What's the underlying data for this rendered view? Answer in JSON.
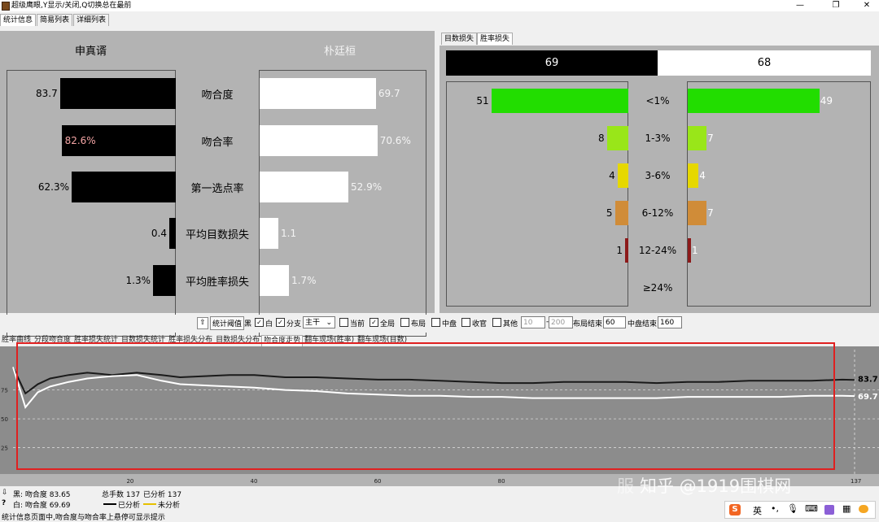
{
  "window": {
    "title": "超级鹰眼,Y显示/关闭,Q切换总在最前",
    "controls": [
      "—",
      "❐",
      "✕"
    ]
  },
  "main_tabs": [
    "统计信息",
    "简易列表",
    "详细列表"
  ],
  "left_stats": {
    "black_player": "申真谞",
    "white_player": "朴廷桓",
    "categories": [
      "吻合度",
      "吻合率",
      "第一选点率",
      "平均目数损失",
      "平均胜率损失"
    ],
    "black_values": [
      83.7,
      82.6,
      62.3,
      0.4,
      1.3
    ],
    "white_values": [
      69.7,
      70.6,
      52.9,
      1.1,
      1.7
    ],
    "black_labels": [
      "83.7",
      "82.6%",
      "62.3%",
      "0.4",
      "1.3%"
    ],
    "white_labels": [
      "69.7",
      "70.6%",
      "52.9%",
      "1.1",
      "1.7%"
    ],
    "black_color": "#000000",
    "white_color": "#ffffff"
  },
  "right_stats": {
    "tabs": [
      "目数损失",
      "胜率损失"
    ],
    "black_total": "69",
    "white_total": "68",
    "ranges": [
      "<1%",
      "1-3%",
      "3-6%",
      "6-12%",
      "12-24%",
      "≥24%"
    ],
    "black_counts": [
      51,
      8,
      4,
      5,
      1,
      0
    ],
    "white_counts": [
      49,
      7,
      4,
      7,
      1,
      0
    ],
    "colors": [
      "#22dd00",
      "#99e619",
      "#e6d800",
      "#d08c38",
      "#8c1a1a",
      "#000000"
    ]
  },
  "controls": {
    "button": "统计阈值",
    "labels": {
      "black": "黑",
      "white": "白",
      "branch": "分支",
      "current": "当前",
      "whole": "全局",
      "opening": "布局",
      "middle": "中盘",
      "end": "收官",
      "other": "其他",
      "opening_end": "布局结束",
      "middle_end": "中盘结束"
    },
    "checked": {
      "black": true,
      "white": true,
      "branch": true,
      "current": false,
      "whole": true,
      "opening": false,
      "middle": false,
      "end": false,
      "other": false
    },
    "select_value": "主干",
    "range_from": "10",
    "range_to": "200",
    "opening_end_value": "60",
    "middle_end_value": "160"
  },
  "bottom_tabs": [
    "胜率曲线",
    "分段吻合度",
    "胜率损失统计",
    "目数损失统计",
    "胜率损失分布",
    "目数损失分布",
    "吻合度走势",
    "翻车现场(胜率)",
    "翻车现场(目数)"
  ],
  "chart_data": {
    "type": "line",
    "title": "吻合度走势",
    "xlabel": "",
    "ylabel": "",
    "xlim": [
      1,
      137
    ],
    "ylim": [
      0,
      110
    ],
    "yticks": [
      25,
      50,
      75
    ],
    "xticks": [
      20,
      40,
      60,
      80,
      137
    ],
    "end_labels": {
      "black": "83.7",
      "white": "69.7"
    },
    "series": [
      {
        "color": "#1a1a1a",
        "x": [
          1,
          3,
          5,
          7,
          10,
          13,
          17,
          21,
          25,
          28,
          32,
          36,
          40,
          45,
          50,
          55,
          60,
          65,
          70,
          75,
          80,
          85,
          90,
          95,
          100,
          105,
          110,
          115,
          120,
          125,
          130,
          135,
          137
        ],
        "y": [
          95,
          72,
          80,
          85,
          88,
          90,
          88,
          90,
          88,
          86,
          87,
          88,
          88,
          86,
          86,
          85,
          84,
          84,
          83,
          82,
          81,
          81,
          82,
          82,
          82,
          81,
          82,
          82,
          83,
          83,
          83,
          84,
          83.7
        ]
      },
      {
        "color": "#ffffff",
        "x": [
          1,
          3,
          5,
          7,
          10,
          13,
          17,
          21,
          25,
          28,
          32,
          36,
          40,
          45,
          50,
          55,
          60,
          65,
          70,
          75,
          80,
          85,
          90,
          95,
          100,
          105,
          110,
          115,
          120,
          125,
          130,
          135,
          137
        ],
        "y": [
          95,
          60,
          73,
          78,
          82,
          85,
          87,
          88,
          83,
          80,
          79,
          78,
          77,
          75,
          74,
          72,
          71,
          70,
          70,
          69,
          69,
          68,
          68,
          68,
          68,
          68,
          69,
          69,
          69,
          69,
          70,
          70,
          69.7
        ]
      }
    ]
  },
  "status": {
    "black_line": "黑: 吻合度 83.65",
    "white_line": "白: 吻合度 69.69",
    "total_moves": "总手数 137",
    "analyzed": "已分析 137",
    "legend_analyzed": "已分析",
    "legend_unanalyzed": "未分析",
    "hint": "统计信息页面中,吻合度与吻合率上悬停可显示提示"
  },
  "watermark": "知乎 @1919围棋网",
  "watermark_faint": "服",
  "ime": {
    "label": "英",
    "icons": [
      "sogou-logo-icon",
      "punctuation-icon",
      "microphone-icon",
      "keyboard-icon",
      "skin-icon",
      "grid-icon",
      "tools-icon"
    ]
  }
}
